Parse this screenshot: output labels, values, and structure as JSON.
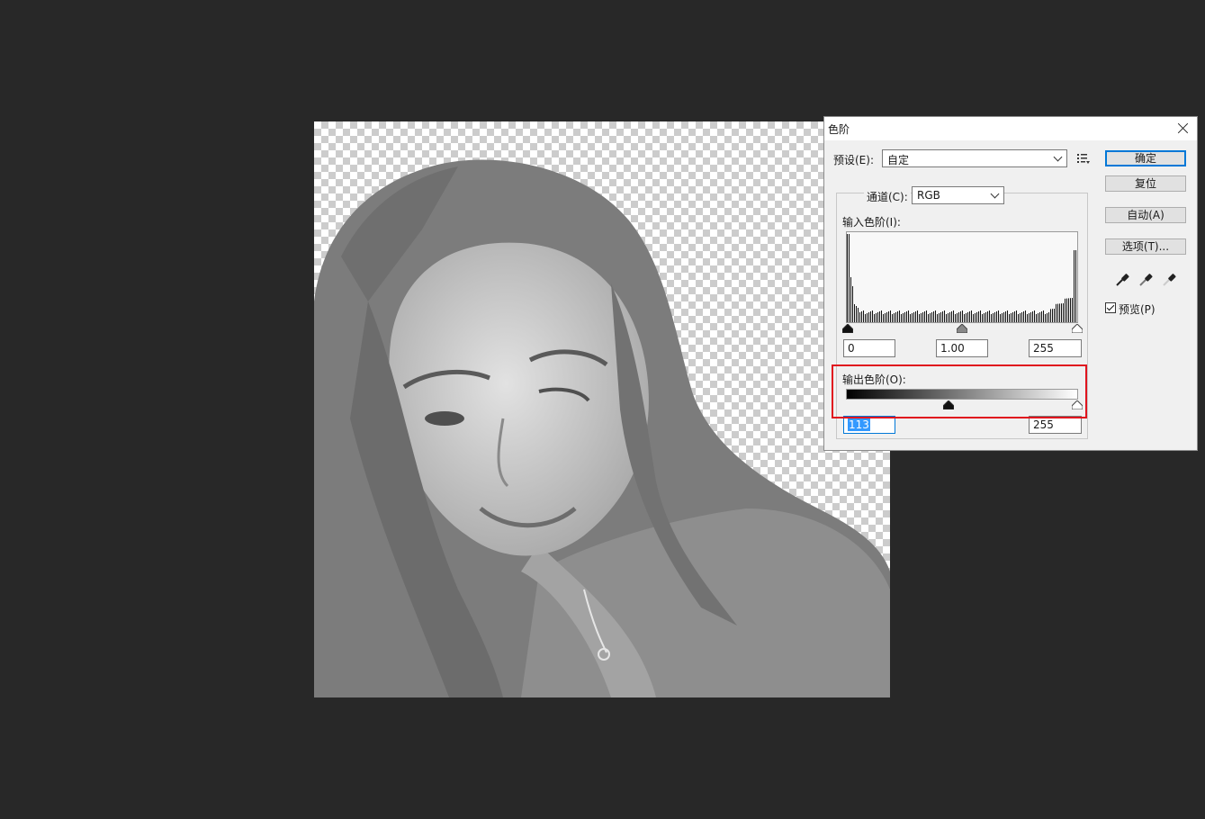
{
  "dialog": {
    "title": "色阶",
    "preset_label": "预设(E):",
    "preset_value": "自定",
    "channel_label": "通道(C):",
    "channel_value": "RGB",
    "input_levels_label": "输入色阶(I):",
    "input_black": "0",
    "input_gamma": "1.00",
    "input_white": "255",
    "output_levels_label": "输出色阶(O):",
    "output_black": "113",
    "output_white": "255",
    "buttons": {
      "ok": "确定",
      "reset": "复位",
      "auto": "自动(A)",
      "options": "选项(T)..."
    },
    "preview_label": "预览(P)",
    "preview_checked": true,
    "icons": [
      "preset-menu-icon",
      "black-eyedropper-icon",
      "gray-eyedropper-icon",
      "white-eyedropper-icon",
      "close-icon"
    ]
  },
  "colors": {
    "background": "#282828",
    "dialog_bg": "#f0f0f0",
    "accent": "#0078d7",
    "highlight": "#e0141e",
    "selection": "#3399ff"
  }
}
